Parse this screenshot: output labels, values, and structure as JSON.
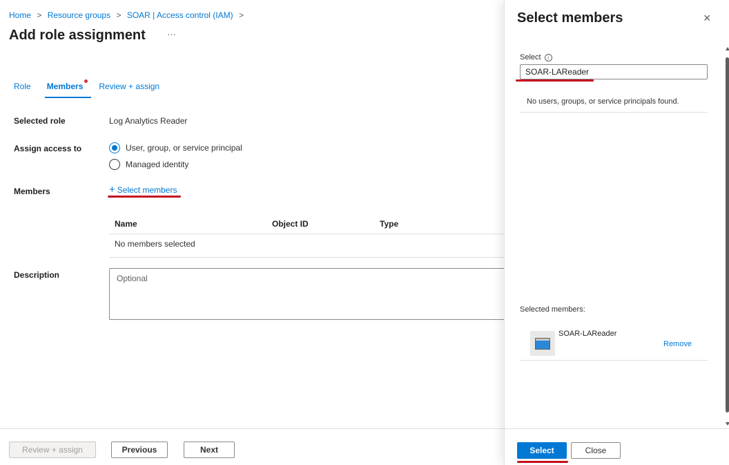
{
  "breadcrumb": [
    "Home",
    "Resource groups",
    "SOAR | Access control (IAM)"
  ],
  "breadcrumb_separator": ">",
  "page_title": "Add role assignment",
  "more_label": "···",
  "tabs": [
    {
      "label": "Role",
      "active": false
    },
    {
      "label": "Members",
      "active": true
    },
    {
      "label": "Review + assign",
      "active": false
    }
  ],
  "form": {
    "selected_role_label": "Selected role",
    "selected_role_value": "Log Analytics Reader",
    "assign_access_label": "Assign access to",
    "assign_options": [
      {
        "label": "User, group, or service principal",
        "checked": true
      },
      {
        "label": "Managed identity",
        "checked": false
      }
    ],
    "members_label": "Members",
    "select_members_plus": "+",
    "select_members_link": "Select members",
    "table_columns": [
      "Name",
      "Object ID",
      "Type"
    ],
    "table_empty_text": "No members selected",
    "description_label": "Description",
    "description_placeholder": "Optional"
  },
  "footer": {
    "review_assign": "Review + assign",
    "previous": "Previous",
    "next": "Next"
  },
  "panel": {
    "title": "Select members",
    "close_icon": "×",
    "select_label": "Select",
    "info_icon": "i",
    "search_value": "SOAR-LAReader",
    "no_results_text": "No users, groups, or service principals found.",
    "selected_members_label": "Selected members:",
    "selected_members": [
      {
        "name": "SOAR-LAReader",
        "remove_label": "Remove"
      }
    ],
    "select_button": "Select",
    "close_button": "Close"
  },
  "colors": {
    "accent": "#0078d4",
    "highlight_underline": "#c50f1f",
    "required_dot": "#d13438"
  },
  "icons": {
    "close": "close-icon",
    "info": "info-icon",
    "more": "more-icon",
    "add": "plus-icon",
    "member": "app-registration-icon"
  }
}
